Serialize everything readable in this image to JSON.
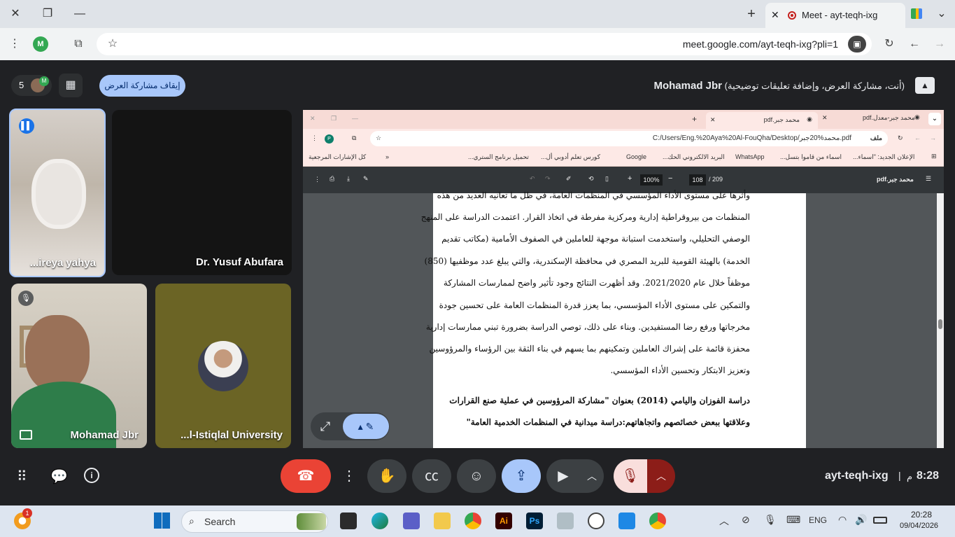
{
  "browser": {
    "tab_title": "Meet - ayt-teqh-ixg",
    "url": "meet.google.com/ayt-teqh-ixg?pli=1",
    "profile_initial": "M"
  },
  "meet": {
    "participant_count": "5",
    "stop_presenting_label": "إيقاف مشاركة العرض",
    "presenter_name": "Mohamad Jbr",
    "presenter_status": "(أنت، مشاركة العرض، وإضافة تعليقات توضيحية)",
    "tiles": [
      {
        "name": "...ireya yahya"
      },
      {
        "name": "Dr. Yusuf Abufara"
      },
      {
        "name": "Mohamad Jbr"
      },
      {
        "name": "...l-Istiqlal University"
      }
    ],
    "meeting_code": "ayt-teqh-ixg",
    "time": "8:28",
    "time_suffix": "م"
  },
  "shared": {
    "tabs": [
      "محمد جبر-معدل.pdf",
      "محمد جبر.pdf"
    ],
    "address": "C:/Users/Eng.%20Aya%20Al-FouQha/Desktop/محمد%20جبر.pdf",
    "address_prefix": "ملف",
    "bookmarks": [
      "الإعلان الجديد: \"اسماء...",
      "اسماء من قاموا بتسل...",
      "WhatsApp",
      "البريد الالكتروني الحك...",
      "Google",
      "كورس تعلم أدوبي أل...",
      "تحميل برنامج الستري...",
      "كل الإشارات المرجعية"
    ],
    "pdf_title": "محمد جبر.pdf",
    "page_current": "108",
    "page_total": "/ 209",
    "zoom": "100%",
    "lines": [
      "وأثرها على مستوى الأداء المؤسسي في المنظمات العامة، في ظل ما تعانيه العديد من هذه",
      "المنظمات من بيروقراطية إدارية ومركزية مفرطة في اتخاذ القرار. اعتمدت الدراسة على المنهج",
      "الوصفي التحليلي، واستخدمت استبانة موجهة للعاملين في الصفوف الأمامية (مكاتب تقديم",
      "الخدمة) بالهيئة القومية للبريد المصري في محافظة الإسكندرية، والتي يبلغ عدد موظفيها (850)",
      "موظفاً خلال عام 2021/2020. وقد أظهرت النتائج وجود تأثير واضح لممارسات المشاركة",
      "والتمكين على مستوى الأداء المؤسسي، بما يعزز قدرة المنظمات العامة على تحسين جودة",
      "مخرجاتها ورفع رضا المستفيدين. وبناء على ذلك، توصي الدراسة بضرورة تبني ممارسات إدارية",
      "محفزة قائمة على إشراك العاملين وتمكينهم بما يسهم في بناء الثقة بين الرؤساء والمرؤوسين",
      "وتعزيز الابتكار وتحسين الأداء المؤسسي."
    ],
    "heading_lines": [
      "دراسة الفوزان واليامي (2014) بعنوان \"مشاركة المرؤوسين في عملية صنع القرارات",
      "وعلاقتها ببعض خصائصهم واتجاهاتهم:دراسة ميدانية في المنظمات الخدمية العامة\""
    ]
  },
  "taskbar": {
    "search_placeholder": "Search",
    "language": "ENG",
    "time": "20:28",
    "date": "09/04/2026",
    "notification_badge": "1"
  }
}
